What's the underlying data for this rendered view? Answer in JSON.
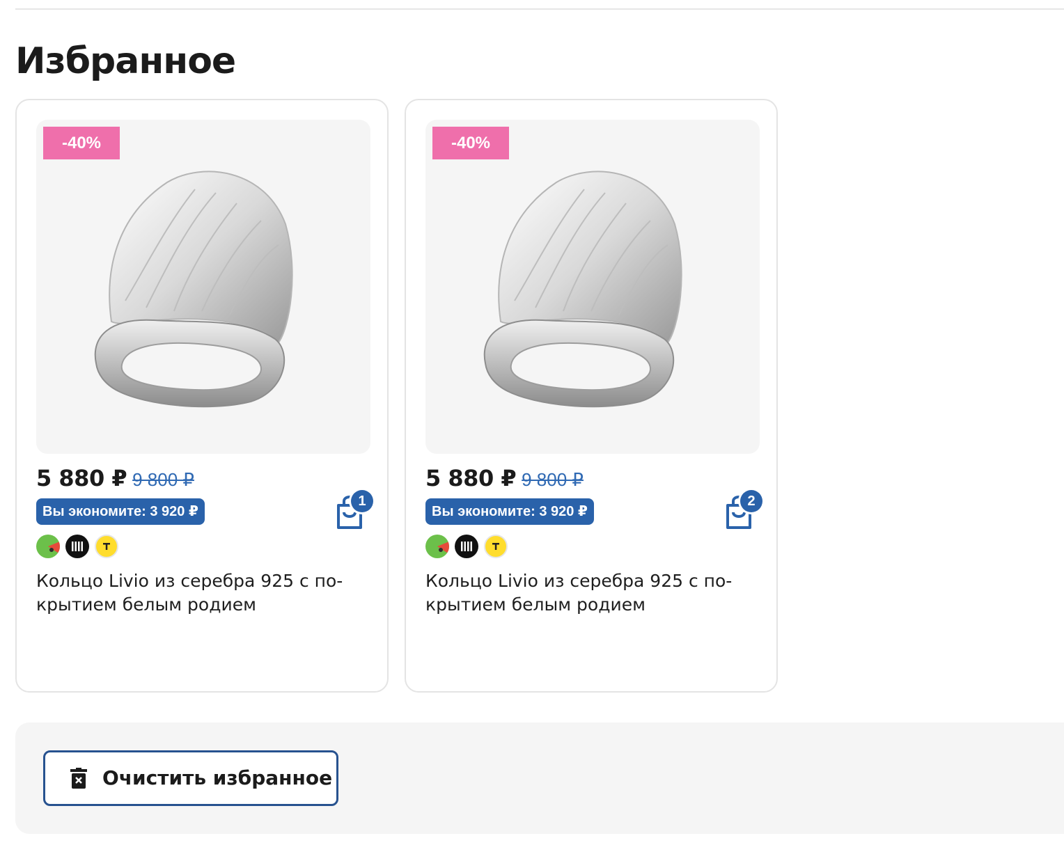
{
  "page": {
    "title": "Избранное"
  },
  "products": [
    {
      "discount": "-40%",
      "price": "5 880 ₽",
      "old_price": "9 800 ₽",
      "savings": "Вы экономите: 3 920 ₽",
      "cart_count": "1",
      "name": "Кольцо Livio из серебра 925 с по-крытием белым родием",
      "payment_icons": [
        "sbp-green-icon",
        "dolyami-black-icon",
        "tbank-yellow-icon"
      ]
    },
    {
      "discount": "-40%",
      "price": "5 880 ₽",
      "old_price": "9 800 ₽",
      "savings": "Вы экономите: 3 920 ₽",
      "cart_count": "2",
      "name": "Кольцо Livio из серебра 925 с по-крытием белым родием",
      "payment_icons": [
        "sbp-green-icon",
        "dolyami-black-icon",
        "tbank-yellow-icon"
      ]
    }
  ],
  "actions": {
    "clear_label": "Очистить избранное"
  },
  "colors": {
    "accent_blue": "#2a62aa",
    "discount_pink": "#ef6fab",
    "button_border": "#27528f"
  }
}
